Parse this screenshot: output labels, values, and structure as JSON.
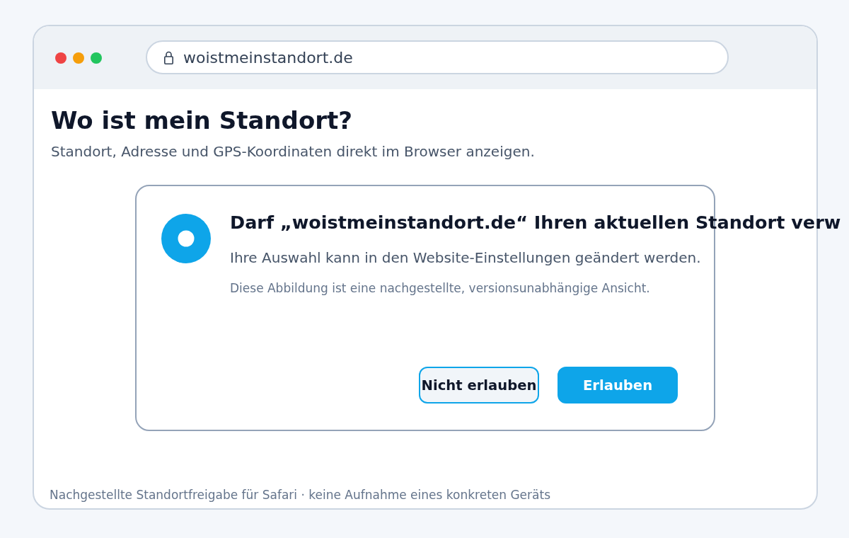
{
  "browser": {
    "window_controls": [
      {
        "color": "#ef4444"
      },
      {
        "color": "#f59e0b"
      },
      {
        "color": "#22c55e"
      }
    ],
    "address_bar": {
      "url": "woistmeinstandort.de"
    }
  },
  "page": {
    "title": "Wo ist mein Standort?",
    "subtitle": "Standort, Adresse und GPS-Koordinaten direkt im Browser anzeigen."
  },
  "permission_dialog": {
    "heading": "Darf „woistmeinstandort.de“ Ihren aktuellen Standort verw",
    "body": "Ihre Auswahl kann in den Website-Einstellungen geändert werden.",
    "note": "Diese Abbildung ist eine nachgestellte, versionsunabhängige Ansicht.",
    "buttons": [
      {
        "label": "Nicht erlauben",
        "kind": "secondary"
      },
      {
        "label": "Erlauben",
        "kind": "primary"
      }
    ]
  },
  "footer": "Nachgestellte Standortfreigabe für Safari · keine Aufnahme eines konkreten Geräts"
}
